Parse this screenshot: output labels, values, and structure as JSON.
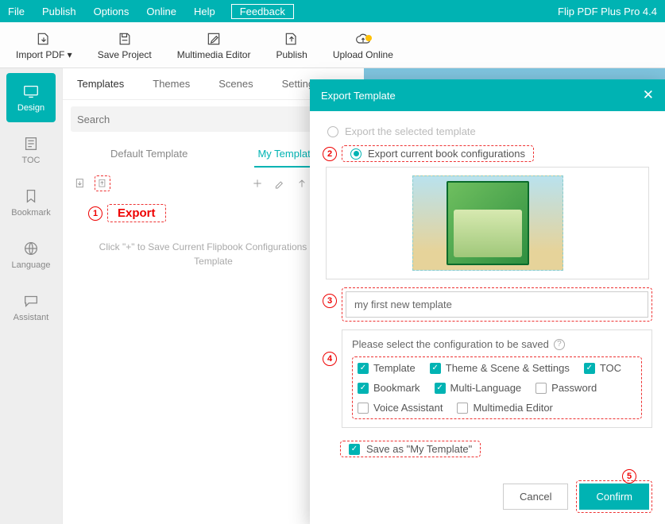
{
  "app": {
    "brand": "Flip PDF Plus Pro 4.4"
  },
  "menu": {
    "file": "File",
    "publish": "Publish",
    "options": "Options",
    "online": "Online",
    "help": "Help",
    "feedback": "Feedback"
  },
  "toolbar": {
    "import": "Import PDF ▾",
    "save": "Save Project",
    "mm": "Multimedia Editor",
    "publish": "Publish",
    "upload": "Upload Online"
  },
  "leftnav": {
    "design": "Design",
    "toc": "TOC",
    "bookmark": "Bookmark",
    "language": "Language",
    "assistant": "Assistant"
  },
  "panel": {
    "tabs": {
      "templates": "Templates",
      "themes": "Themes",
      "scenes": "Scenes",
      "settings": "Settings"
    },
    "search_ph": "Search",
    "subtabs": {
      "default": "Default Template",
      "my": "My Template"
    },
    "hint": "Click \"+\" to Save Current Flipbook Configurations as a Template"
  },
  "annot": {
    "export": "Export",
    "n1": "1",
    "n2": "2",
    "n3": "3",
    "n4": "4",
    "n5": "5"
  },
  "modal": {
    "title": "Export Template",
    "opt_sel": "Export the selected template",
    "opt_cur": "Export current book configurations",
    "name": "my first new template",
    "cfg_title": "Please select the configuration to be saved",
    "chk": {
      "template": "Template",
      "theme": "Theme & Scene & Settings",
      "toc": "TOC",
      "bookmark": "Bookmark",
      "multi": "Multi-Language",
      "password": "Password",
      "voice": "Voice Assistant",
      "mm": "Multimedia Editor"
    },
    "saveas": "Save as \"My Template\"",
    "cancel": "Cancel",
    "confirm": "Confirm"
  }
}
